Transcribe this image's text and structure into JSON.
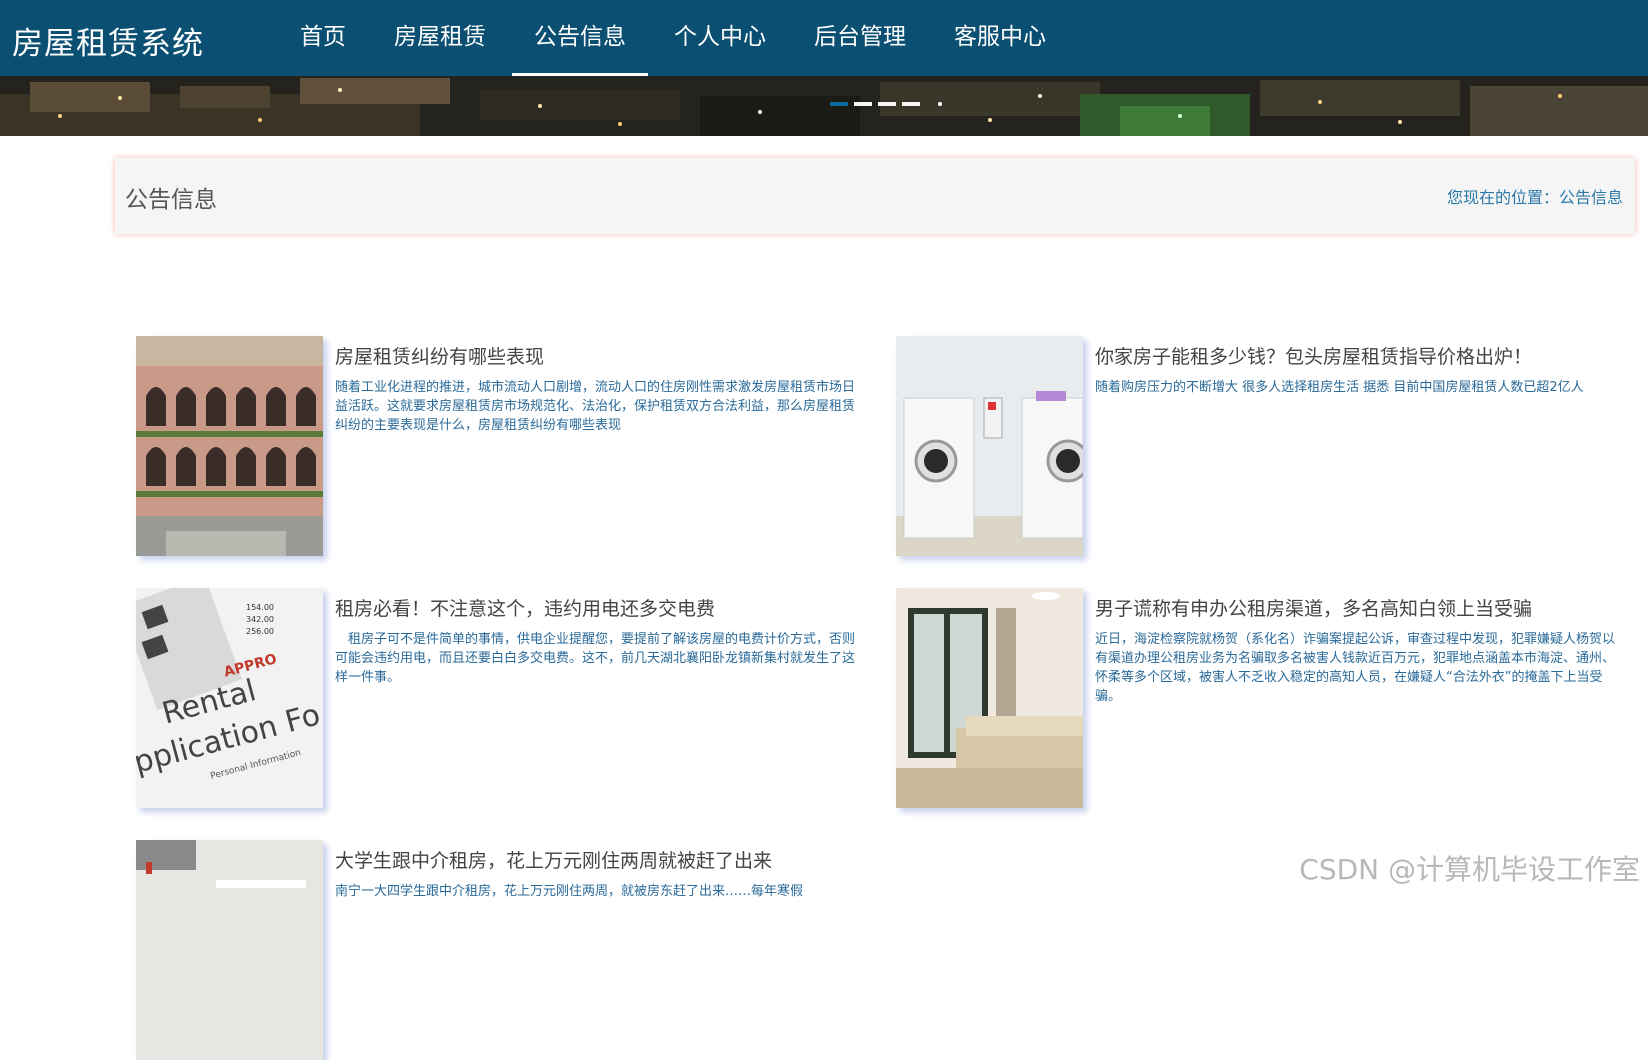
{
  "header": {
    "brand": "房屋租赁系统",
    "nav": [
      {
        "label": "首页"
      },
      {
        "label": "房屋租赁"
      },
      {
        "label": "公告信息",
        "active": true
      },
      {
        "label": "个人中心"
      },
      {
        "label": "后台管理"
      },
      {
        "label": "客服中心"
      }
    ]
  },
  "banner": {
    "slide_count": 4,
    "active_slide": 1
  },
  "page": {
    "title": "公告信息",
    "location": "您现在的位置：公告信息"
  },
  "news": [
    {
      "title": "房屋租赁纠纷有哪些表现",
      "summary": "随着工业化进程的推进，城市流动人口剧增，流动人口的住房刚性需求激发房屋租赁市场日益活跃。这就要求房屋租赁房市场规范化、法治化，保护租赁双方合法利益，那么房屋租赁纠纷的主要表现是什么，房屋租赁纠纷有哪些表现"
    },
    {
      "title": "你家房子能租多少钱？包头房屋租赁指导价格出炉！",
      "summary": "随着购房压力的不断增大 很多人选择租房生活 据悉 目前中国房屋租赁人数已超2亿人"
    },
    {
      "title": "租房必看！不注意这个，违约用电还多交电费",
      "summary": "　租房子可不是件简单的事情，供电企业提醒您，要提前了解该房屋的电费计价方式，否则可能会违约用电，而且还要白白多交电费。这不，前几天湖北襄阳卧龙镇新集村就发生了这样一件事。"
    },
    {
      "title": "男子谎称有申办公租房渠道，多名高知白领上当受骗",
      "summary": "近日，海淀检察院就杨贺（系化名）诈骗案提起公诉，审查过程中发现，犯罪嫌疑人杨贺以有渠道办理公租房业务为名骗取多名被害人钱款近百万元，犯罪地点涵盖本市海淀、通州、怀柔等多个区域，被害人不乏收入稳定的高知人员，在嫌疑人“合法外衣”的掩盖下上当受骗。"
    },
    {
      "title": "大学生跟中介租房，花上万元刚住两周就被赶了出来",
      "summary": "南宁一大四学生跟中介租房，花上万元刚住两周，就被房东赶了出来……每年寒假"
    }
  ],
  "thumb_text": {
    "numbers": [
      "154.00",
      "342.00",
      "256.00"
    ],
    "form_line1": "Rental",
    "form_line2": "pplication Fo",
    "stamp": "APPRO",
    "form_sub": "Personal Information"
  },
  "watermark": "CSDN @计算机毕设工作室",
  "colors": {
    "header": "#0b4f72",
    "link": "#2b79a8"
  }
}
